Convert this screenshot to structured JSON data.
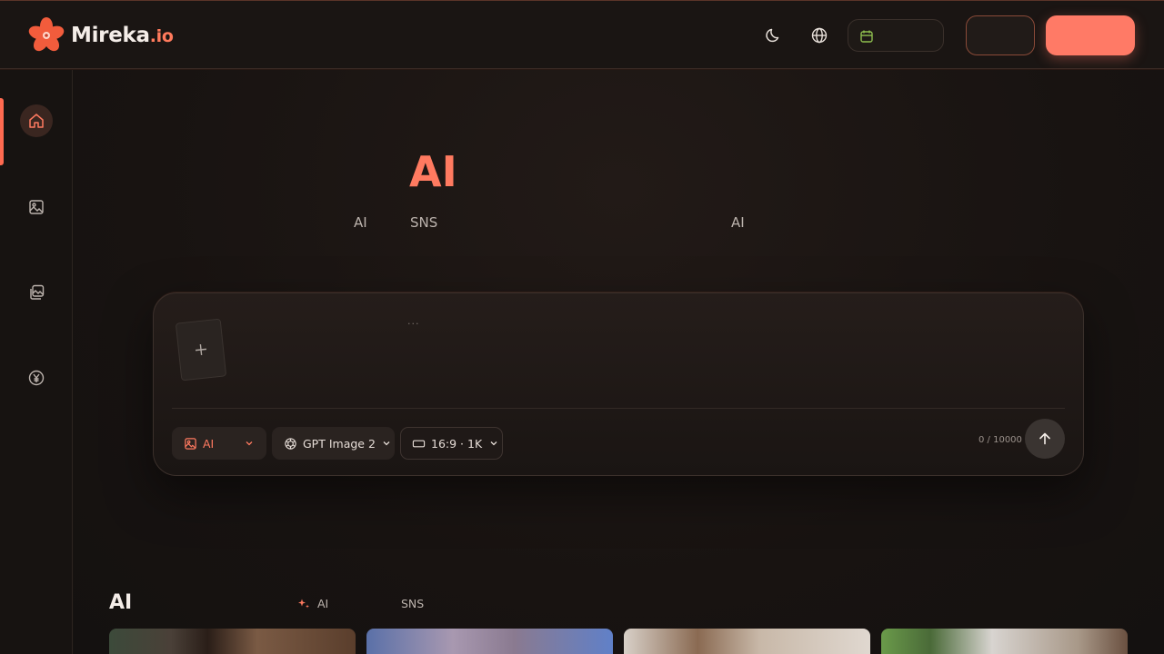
{
  "header": {
    "brand_name": "Mireka",
    "brand_suffix": ".io",
    "theme_toggle_icon": "moon-icon",
    "language_icon": "globe-icon",
    "credits_icon": "calendar-icon",
    "credits_label": "",
    "login_label": "",
    "signup_label": "",
    "colors": {
      "accent": "#ff7a60",
      "signup_bg": "#ff7a66"
    }
  },
  "sidebar": {
    "items": [
      {
        "name": "home",
        "icon": "home-icon",
        "active": true
      },
      {
        "name": "images",
        "icon": "image-icon",
        "active": false
      },
      {
        "name": "gallery",
        "icon": "gallery-icon",
        "active": false
      },
      {
        "name": "pricing",
        "icon": "yen-coin-icon",
        "active": false
      }
    ]
  },
  "hero": {
    "title": "AI",
    "subtitle_parts": [
      "AI",
      "SNS",
      "AI"
    ]
  },
  "prompt": {
    "placeholder": "...",
    "upload_icon": "plus-icon",
    "mode_label": "AI",
    "model_label": "GPT Image 2",
    "ratio_label": "16:9 · 1K",
    "counter": "0 / 10000",
    "send_icon": "arrow-up-icon"
  },
  "gallery": {
    "title": "AI",
    "tabs": [
      {
        "label": "AI",
        "icon": "sparkle-icon"
      },
      {
        "label": "SNS"
      }
    ]
  }
}
